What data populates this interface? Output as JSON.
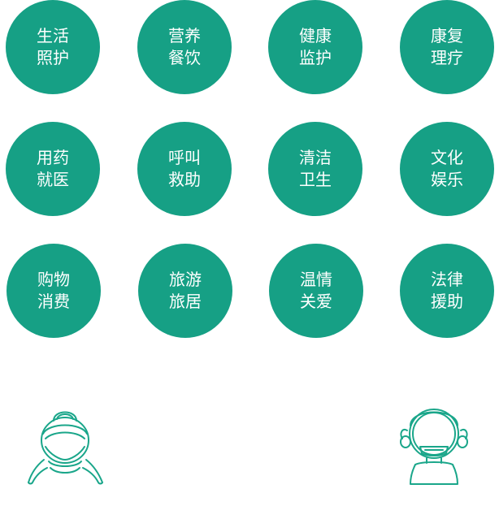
{
  "colors": {
    "circle_fill": "#16a085",
    "circle_text": "#ffffff",
    "figure_stroke": "#1aa68a"
  },
  "services": [
    {
      "line1": "生活",
      "line2": "照护"
    },
    {
      "line1": "营养",
      "line2": "餐饮"
    },
    {
      "line1": "健康",
      "line2": "监护"
    },
    {
      "line1": "康复",
      "line2": "理疗"
    },
    {
      "line1": "用药",
      "line2": "就医"
    },
    {
      "line1": "呼叫",
      "line2": "救助"
    },
    {
      "line1": "清洁",
      "line2": "卫生"
    },
    {
      "line1": "文化",
      "line2": "娱乐"
    },
    {
      "line1": "购物",
      "line2": "消费"
    },
    {
      "line1": "旅游",
      "line2": "旅居"
    },
    {
      "line1": "温情",
      "line2": "关爱"
    },
    {
      "line1": "法律",
      "line2": "援助"
    }
  ],
  "figures": {
    "left_icon": "elderly-woman-icon",
    "right_icon": "elderly-man-icon"
  }
}
